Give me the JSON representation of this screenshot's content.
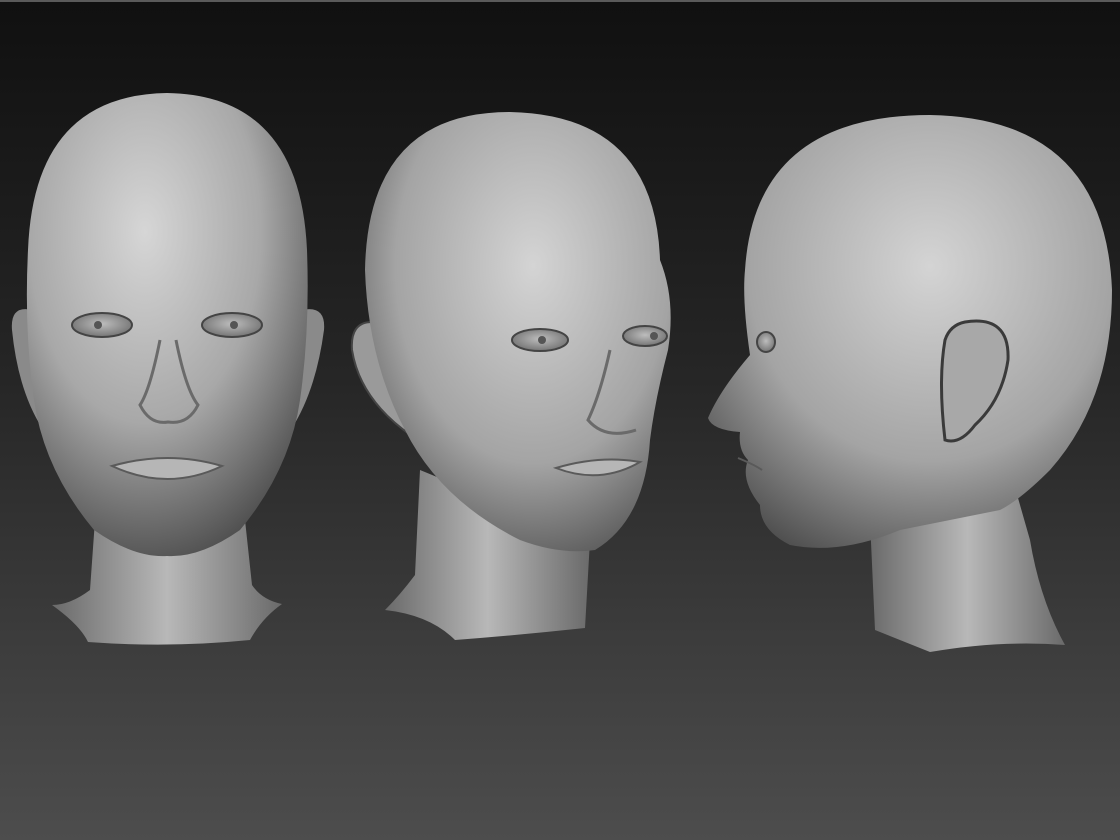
{
  "scene": {
    "colors": {
      "background_top": "#111111",
      "background_bottom": "#4c4c4c",
      "sculpt_light": "#d2d2d2",
      "sculpt_mid": "#9a9a9a",
      "sculpt_dark": "#3a3a3a"
    },
    "views": [
      {
        "name": "front"
      },
      {
        "name": "three-quarter"
      },
      {
        "name": "profile"
      }
    ]
  }
}
